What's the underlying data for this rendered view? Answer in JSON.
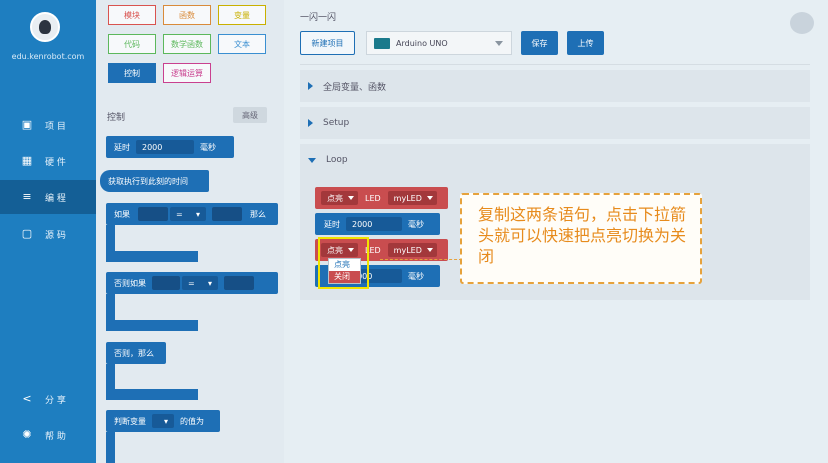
{
  "nav": {
    "site": "edu.kenrobot.com",
    "items": [
      {
        "label": "项 目",
        "icon": "folder-icon"
      },
      {
        "label": "硬 件",
        "icon": "chip-icon"
      },
      {
        "label": "编 程",
        "icon": "list-icon"
      },
      {
        "label": "源 码",
        "icon": "code-icon"
      }
    ],
    "bottom": [
      {
        "label": "分 享",
        "icon": "share-icon"
      },
      {
        "label": "帮 助",
        "icon": "help-icon"
      }
    ]
  },
  "palette": {
    "categories": [
      "模块",
      "函数",
      "变量",
      "代码",
      "数学函数",
      "文本",
      "控制",
      "逻辑运算"
    ],
    "category_colors": [
      "#d9534f",
      "#d98b3a",
      "#c9b000",
      "#5cb85c",
      "#5cb85c",
      "#3a8fd1",
      "#1e6fb5",
      "#c9408f"
    ],
    "section_title": "控制",
    "advanced": "高级",
    "blocks": {
      "delay_label": "延时",
      "delay_value": "2000",
      "delay_unit": "毫秒",
      "millis_label": "获取执行到此刻的时间",
      "if_label": "如果",
      "if_op": "=",
      "if_then": "那么",
      "elseif_label": "否则如果",
      "elseif_op": "=",
      "else_label": "否则，那么",
      "judge_label": "判断变量",
      "judge_suffix": "的值为"
    }
  },
  "main": {
    "project_title": "一闪一闪",
    "new_project": "新建项目",
    "board": "Arduino UNO",
    "save": "保存",
    "upload": "上传",
    "sections": [
      "全局变量、函数",
      "Setup",
      "Loop"
    ],
    "loop_blocks": {
      "state1": "点亮",
      "led": "LED",
      "led_var": "myLED",
      "delay_label": "延时",
      "delay_value": "2000",
      "delay_unit": "毫秒",
      "state2": "点亮",
      "delay2_value": "2000",
      "delay2_unit": "毫秒"
    },
    "dropdown_options": [
      "点亮",
      "关闭"
    ],
    "callout": "复制这两条语句，点击下拉箭头就可以快速把点亮切换为关闭"
  }
}
